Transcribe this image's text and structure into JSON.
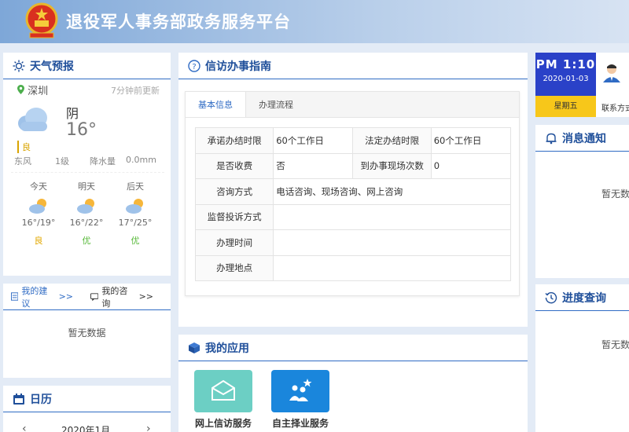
{
  "header": {
    "title": "退役军人事务部政务服务平台"
  },
  "weather": {
    "title": "天气预报",
    "location": "深圳",
    "updated": "7分钟前更新",
    "condition": "阴",
    "temp": "16°",
    "aq": "良",
    "wind_dir": "东风",
    "wind_level": "1级",
    "precip_label": "降水量",
    "precip": "0.0mm",
    "forecast": [
      {
        "day": "今天",
        "temp": "16°/19°",
        "aq": "良",
        "aq_color": "#e2a800"
      },
      {
        "day": "明天",
        "temp": "16°/22°",
        "aq": "优",
        "aq_color": "#58b93a"
      },
      {
        "day": "后天",
        "temp": "17°/25°",
        "aq": "优",
        "aq_color": "#58b93a"
      }
    ]
  },
  "feedback": {
    "tab1": "我的建议",
    "tab2": "我的咨询",
    "arrow": ">>",
    "empty": "暂无数据"
  },
  "calendar": {
    "title": "日历",
    "month": "2020年1月"
  },
  "guide": {
    "title": "信访办事指南",
    "tabs": [
      "基本信息",
      "办理流程"
    ],
    "rows": [
      [
        "承诺办结时限",
        "60个工作日",
        "法定办结时限",
        "60个工作日"
      ],
      [
        "是否收费",
        "否",
        "到办事现场次数",
        "0"
      ],
      [
        "咨询方式",
        "电话咨询、现场咨询、网上咨询"
      ],
      [
        "监督投诉方式",
        ""
      ],
      [
        "办理时间",
        ""
      ],
      [
        "办理地点",
        ""
      ]
    ]
  },
  "apps": {
    "title": "我的应用",
    "items": [
      {
        "label": "网上信访服务",
        "color": "#6ccfc4"
      },
      {
        "label": "自主择业服务",
        "color": "#1a86dc"
      }
    ]
  },
  "clock": {
    "time": "PM  1:10",
    "date": "2020-01-03",
    "weekday": "星期五",
    "contact": "联系方式"
  },
  "notice": {
    "title": "消息通知",
    "empty": "暂无数"
  },
  "progress": {
    "title": "进度查询",
    "empty": "暂无数"
  },
  "colors": {
    "accent": "#2f6bc4",
    "title": "#1f4f9a",
    "clock": "#2a41c8",
    "weekday": "#f7c71a"
  }
}
